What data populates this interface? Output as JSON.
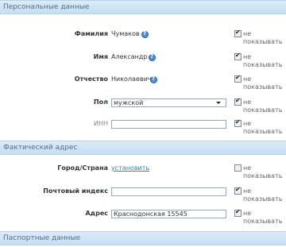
{
  "sections": {
    "personal": {
      "title": "Персональные данные"
    },
    "address": {
      "title": "Фактический адрес"
    },
    "passport": {
      "title": "Паспортные данные"
    }
  },
  "fields": {
    "surname": {
      "label": "Фамилия",
      "value": "Чумаков",
      "hide_checked": true,
      "hide_label": "не показывать"
    },
    "name": {
      "label": "Имя",
      "value": "Александр",
      "hide_checked": true,
      "hide_label": "не показывать"
    },
    "patronymic": {
      "label": "Отчество",
      "value": "Николаевич",
      "hide_checked": true,
      "hide_label": "не показывать"
    },
    "gender": {
      "label": "Пол",
      "value": "мужской",
      "hide_checked": true,
      "hide_label": "не показывать"
    },
    "inn": {
      "label": "ИНН",
      "value": "",
      "hide_checked": true,
      "hide_label": "не показывать"
    },
    "city": {
      "label": "Город/Страна",
      "link": "установить",
      "hide_checked": false,
      "hide_label": "не показывать"
    },
    "postcode": {
      "label": "Почтовый индекс",
      "value": "",
      "hide_checked": true,
      "hide_label": "не показывать"
    },
    "street": {
      "label": "Адрес",
      "value": "Краснодонская 15545",
      "hide_checked": true,
      "hide_label": "не показывать"
    }
  },
  "icons": {
    "help": "help-question-icon",
    "checkbox": "checkbox-icon"
  },
  "colors": {
    "header_bg": "#c6def2",
    "header_text": "#4f6f8f",
    "link": "#3a7cc0",
    "help": "#4f8fd0"
  }
}
